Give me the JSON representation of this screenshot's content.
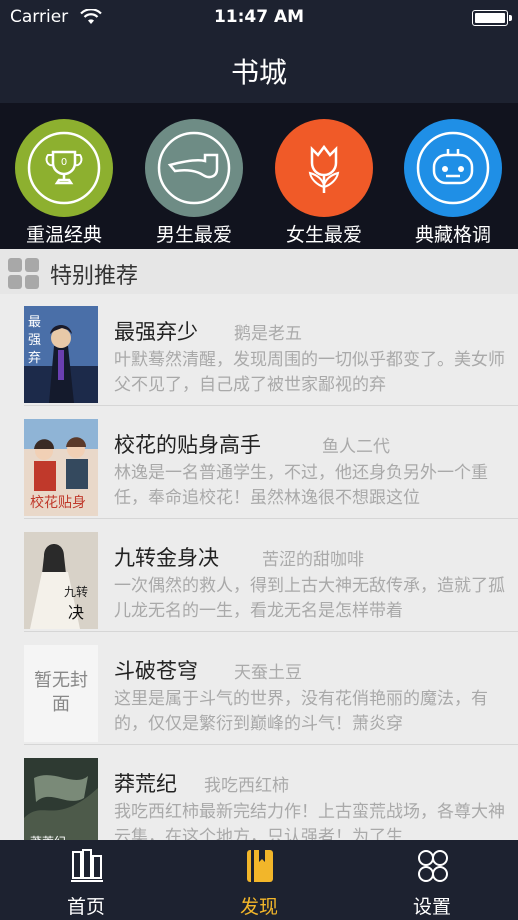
{
  "status_bar": {
    "carrier": "Carrier",
    "time": "11:47 AM"
  },
  "navbar": {
    "title": "书城"
  },
  "categories": [
    {
      "label": "重温经典",
      "icon": "trophy-icon",
      "color": "#8db02f"
    },
    {
      "label": "男生最爱",
      "icon": "pipe-icon",
      "color": "#6e8c85"
    },
    {
      "label": "女生最爱",
      "icon": "tulip-icon",
      "color": "#f05a28"
    },
    {
      "label": "典藏格调",
      "icon": "robot-icon",
      "color": "#1f8fe6"
    }
  ],
  "section": {
    "title": "特别推荐"
  },
  "books": [
    {
      "title": "最强弃少",
      "author": "鹅是老五",
      "desc": "叶默蓦然清醒，发现周围的一切似乎都变了。美女师父不见了，自己成了被世家鄙视的弃"
    },
    {
      "title": "校花的贴身高手",
      "author": "鱼人二代",
      "desc": "林逸是一名普通学生，不过，他还身负另外一个重任，奉命追校花！虽然林逸很不想跟这位"
    },
    {
      "title": "九转金身决",
      "author": "苦涩的甜咖啡",
      "desc": "一次偶然的救人，得到上古大神无敌传承，造就了孤儿龙无名的一生，看龙无名是怎样带着"
    },
    {
      "title": "斗破苍穹",
      "author": "天蚕土豆",
      "desc": "这里是属于斗气的世界，没有花俏艳丽的魔法，有的，仅仅是繁衍到巅峰的斗气！萧炎穿",
      "cover_text": "暂无封面"
    },
    {
      "title": "莽荒纪",
      "author": "我吃西红柿",
      "desc": "我吃西红柿最新完结力作！上古蛮荒战场，各尊大神云集，在这个地方，只认强者！为了生"
    }
  ],
  "tabs": [
    {
      "label": "首页",
      "icon": "bookshelf-icon",
      "active": false
    },
    {
      "label": "发现",
      "icon": "book-icon",
      "active": true
    },
    {
      "label": "设置",
      "icon": "settings-icon",
      "active": false
    }
  ]
}
